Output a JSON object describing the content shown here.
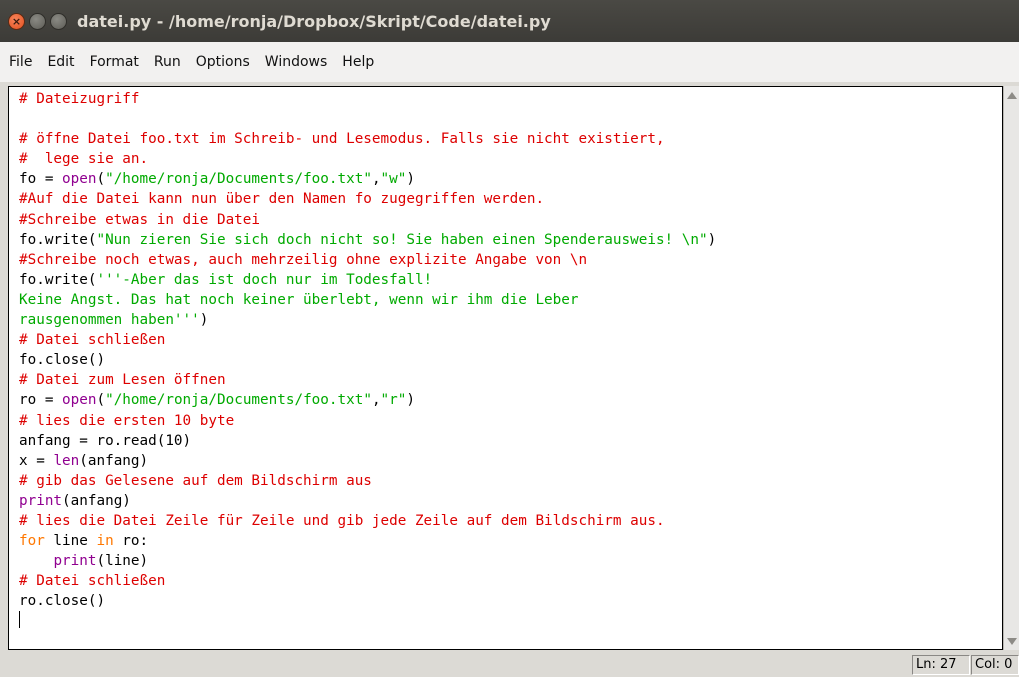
{
  "window": {
    "title": "datei.py - /home/ronja/Dropbox/Skript/Code/datei.py",
    "close_glyph": "×",
    "min_glyph": "",
    "max_glyph": ""
  },
  "menu": {
    "items": [
      "File",
      "Edit",
      "Format",
      "Run",
      "Options",
      "Windows",
      "Help"
    ]
  },
  "editor": {
    "lines": [
      [
        [
          "c",
          "# Dateizugriff"
        ]
      ],
      [],
      [
        [
          "c",
          "# öffne Datei foo.txt im Schreib- und Lesemodus. Falls sie nicht existiert,"
        ]
      ],
      [
        [
          "c",
          "#  lege sie an."
        ]
      ],
      [
        [
          "p",
          "fo = "
        ],
        [
          "b",
          "open"
        ],
        [
          "p",
          "("
        ],
        [
          "s",
          "\"/home/ronja/Documents/foo.txt\""
        ],
        [
          "p",
          ","
        ],
        [
          "s",
          "\"w\""
        ],
        [
          "p",
          ")"
        ]
      ],
      [
        [
          "c",
          "#Auf die Datei kann nun über den Namen fo zugegriffen werden."
        ]
      ],
      [
        [
          "c",
          "#Schreibe etwas in die Datei"
        ]
      ],
      [
        [
          "p",
          "fo.write("
        ],
        [
          "s",
          "\"Nun zieren Sie sich doch nicht so! Sie haben einen Spenderausweis! \\n\""
        ],
        [
          "p",
          ")"
        ]
      ],
      [
        [
          "c",
          "#Schreibe noch etwas, auch mehrzeilig ohne explizite Angabe von \\n"
        ]
      ],
      [
        [
          "p",
          "fo.write("
        ],
        [
          "s",
          "'''-Aber das ist doch nur im Todesfall!"
        ]
      ],
      [
        [
          "s",
          "Keine Angst. Das hat noch keiner überlebt, wenn wir ihm die Leber"
        ]
      ],
      [
        [
          "s",
          "rausgenommen haben'''"
        ],
        [
          "p",
          ")"
        ]
      ],
      [
        [
          "c",
          "# Datei schließen"
        ]
      ],
      [
        [
          "p",
          "fo.close()"
        ]
      ],
      [
        [
          "c",
          "# Datei zum Lesen öffnen"
        ]
      ],
      [
        [
          "p",
          "ro = "
        ],
        [
          "b",
          "open"
        ],
        [
          "p",
          "("
        ],
        [
          "s",
          "\"/home/ronja/Documents/foo.txt\""
        ],
        [
          "p",
          ","
        ],
        [
          "s",
          "\"r\""
        ],
        [
          "p",
          ")"
        ]
      ],
      [
        [
          "c",
          "# lies die ersten 10 byte"
        ]
      ],
      [
        [
          "p",
          "anfang = ro.read(10)"
        ]
      ],
      [
        [
          "p",
          "x = "
        ],
        [
          "b",
          "len"
        ],
        [
          "p",
          "(anfang)"
        ]
      ],
      [
        [
          "c",
          "# gib das Gelesene auf dem Bildschirm aus"
        ]
      ],
      [
        [
          "b",
          "print"
        ],
        [
          "p",
          "(anfang)"
        ]
      ],
      [
        [
          "c",
          "# lies die Datei Zeile für Zeile und gib jede Zeile auf dem Bildschirm aus."
        ]
      ],
      [
        [
          "k",
          "for"
        ],
        [
          "p",
          " line "
        ],
        [
          "k",
          "in"
        ],
        [
          "p",
          " ro:"
        ]
      ],
      [
        [
          "p",
          "    "
        ],
        [
          "b",
          "print"
        ],
        [
          "p",
          "(line)"
        ]
      ],
      [
        [
          "c",
          "# Datei schließen"
        ]
      ],
      [
        [
          "p",
          "ro.close()"
        ]
      ],
      []
    ]
  },
  "status": {
    "ln": "Ln: 27",
    "col": "Col: 0"
  },
  "colors": {
    "comment": "#dd0000",
    "string": "#00aa00",
    "builtin": "#900090",
    "keyword": "#ff7700"
  }
}
